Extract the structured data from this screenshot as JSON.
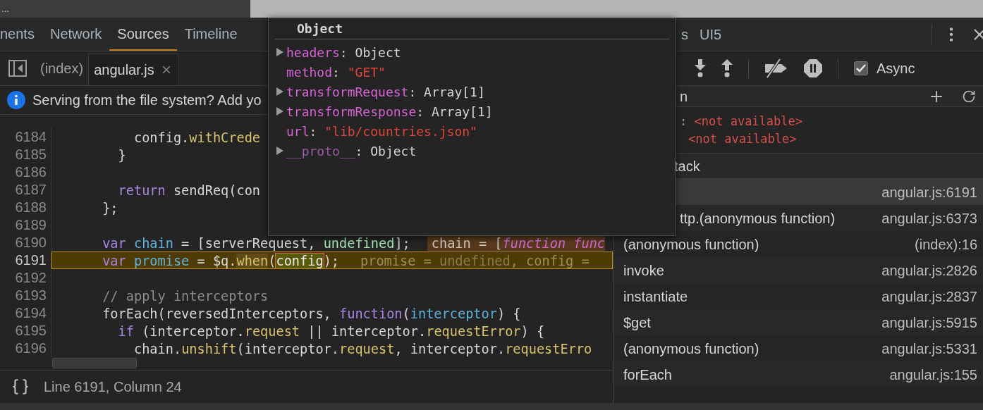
{
  "window": {
    "title": "..."
  },
  "tabs": [
    {
      "label": "nents",
      "selected": false
    },
    {
      "label": "Network",
      "selected": false
    },
    {
      "label": "Sources",
      "selected": true
    },
    {
      "label": "Timeline",
      "selected": false
    }
  ],
  "right_tabs": [
    {
      "label": "s",
      "selected": false
    },
    {
      "label": "UI5",
      "selected": false
    }
  ],
  "file_tabs": [
    {
      "label": "(index)",
      "selected": false,
      "closable": false
    },
    {
      "label": "angular.js",
      "selected": true,
      "closable": true
    }
  ],
  "info_bar": {
    "text": "Serving from the file system? Add yo"
  },
  "code": {
    "lines": [
      {
        "number": "6184",
        "current": false,
        "tokens": [
          {
            "t": "          config."
          },
          {
            "t": "withCrede",
            "kind": "prop"
          }
        ]
      },
      {
        "number": "6185",
        "current": false,
        "tokens": [
          {
            "t": "        }"
          }
        ]
      },
      {
        "number": "6186",
        "current": false
      },
      {
        "number": "6187",
        "current": false,
        "tokens": [
          {
            "t": "        return",
            "kind": "kw"
          },
          {
            "t": " sendReq(con"
          }
        ]
      },
      {
        "number": "6188",
        "current": false,
        "tokens": [
          {
            "t": "      };"
          }
        ]
      },
      {
        "number": "6189",
        "current": false
      },
      {
        "number": "6190",
        "current": false,
        "tokens": [
          {
            "t": "      var",
            "kind": "kw"
          },
          {
            "t": " chain",
            "kind": "var"
          },
          {
            "t": " = [serverRequest, "
          },
          {
            "t": "undefined",
            "kind": "lit"
          },
          {
            "t": "];"
          }
        ],
        "inline": [
          {
            "t": "chain = ["
          },
          {
            "t": "function func",
            "kind": "fn"
          }
        ]
      },
      {
        "number": "6191",
        "current": true,
        "tokens": [
          {
            "t": "      var",
            "kind": "kw"
          },
          {
            "t": " promise",
            "kind": "var"
          },
          {
            "t": " = $q."
          },
          {
            "t": "when",
            "kind": "hlprop"
          },
          {
            "t": "("
          },
          {
            "t": "config",
            "kind": "hl"
          },
          {
            "t": ");"
          }
        ],
        "inline": [
          {
            "t": "promise = "
          },
          {
            "t": "undefined",
            "kind": "dim"
          },
          {
            "t": ", config ="
          }
        ]
      },
      {
        "number": "6192",
        "current": false
      },
      {
        "number": "6193",
        "current": false,
        "tokens": [
          {
            "t": "      // apply interceptors",
            "kind": "comment"
          }
        ]
      },
      {
        "number": "6194",
        "current": false,
        "tokens": [
          {
            "t": "      forEach(reversedInterceptors, "
          },
          {
            "t": "function",
            "kind": "kw"
          },
          {
            "t": "("
          },
          {
            "t": "interceptor",
            "kind": "var"
          },
          {
            "t": ") {"
          }
        ]
      },
      {
        "number": "6195",
        "current": false,
        "tokens": [
          {
            "t": "        if",
            "kind": "kw"
          },
          {
            "t": " (interceptor."
          },
          {
            "t": "request",
            "kind": "prop"
          },
          {
            "t": " || interceptor."
          },
          {
            "t": "requestError",
            "kind": "prop"
          },
          {
            "t": ") {"
          }
        ]
      },
      {
        "number": "6196",
        "current": false,
        "tokens": [
          {
            "t": "          chain."
          },
          {
            "t": "unshift",
            "kind": "prop"
          },
          {
            "t": "(interceptor."
          },
          {
            "t": "request",
            "kind": "prop"
          },
          {
            "t": ", interceptor."
          },
          {
            "t": "requestErro",
            "kind": "prop"
          }
        ]
      }
    ]
  },
  "status_bar": {
    "text": "Line 6191, Column 24"
  },
  "popover": {
    "title": "Object",
    "entries": [
      {
        "key": "headers",
        "separator": ":",
        "value": "Object",
        "kind": "object",
        "expandable": true
      },
      {
        "key": "method",
        "separator": ":",
        "value": "\"GET\"",
        "kind": "string",
        "expandable": false
      },
      {
        "key": "transformRequest",
        "separator": ":",
        "value": "Array[1]",
        "kind": "object",
        "expandable": true
      },
      {
        "key": "transformResponse",
        "separator": ":",
        "value": "Array[1]",
        "kind": "object",
        "expandable": true
      },
      {
        "key": "url",
        "separator": ":",
        "value": "\"lib/countries.json\"",
        "kind": "string",
        "expandable": false
      },
      {
        "key": "__proto__",
        "separator": ":",
        "value": "Object",
        "kind": "object",
        "expandable": true,
        "dim": true
      }
    ]
  },
  "toolbar": {
    "async": {
      "label": "Async",
      "checked": true
    }
  },
  "watch": {
    "header": "n",
    "items": [
      {
        "separator": ":",
        "value": "<not available>"
      },
      {
        "value": "<not available>"
      }
    ]
  },
  "call_stack": {
    "header": "tack",
    "frames": [
      {
        "location": "angular.js:6191",
        "selected": true
      },
      {
        "name": "ttp.(anonymous function)",
        "location": "angular.js:6373",
        "selected": false,
        "partial": true
      },
      {
        "name": "(anonymous function)",
        "location": "(index):16",
        "selected": false
      },
      {
        "name": "invoke",
        "location": "angular.js:2826",
        "selected": false
      },
      {
        "name": "instantiate",
        "location": "angular.js:2837",
        "selected": false
      },
      {
        "name": "$get",
        "location": "angular.js:5915",
        "selected": false
      },
      {
        "name": "(anonymous function)",
        "location": "angular.js:5331",
        "selected": false
      },
      {
        "name": "forEach",
        "location": "angular.js:155",
        "selected": false
      }
    ]
  }
}
